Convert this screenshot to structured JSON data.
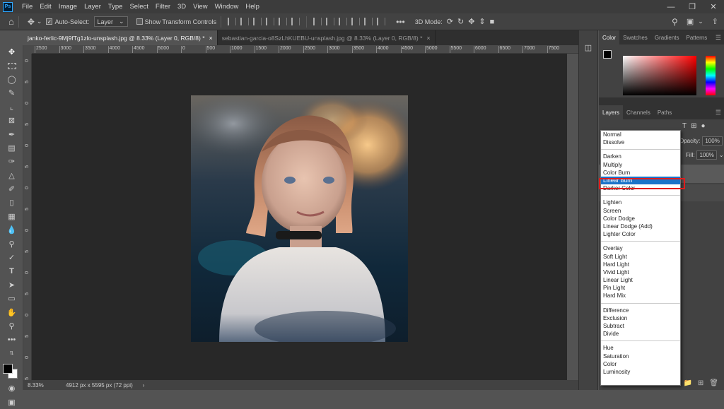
{
  "app": {
    "logo": "Ps"
  },
  "menu": [
    "File",
    "Edit",
    "Image",
    "Layer",
    "Type",
    "Select",
    "Filter",
    "3D",
    "View",
    "Window",
    "Help"
  ],
  "options": {
    "auto_select_label": "Auto-Select:",
    "auto_select_value": "Layer",
    "show_transform_label": "Show Transform Controls",
    "mode_3d_label": "3D Mode:"
  },
  "tabs": [
    {
      "label": "janko-ferlic-9Mj9fTg1zlo-unsplash.jpg @ 8.33% (Layer 0, RGB/8) *",
      "active": true
    },
    {
      "label": "sebastian-garcia-o8SzLhKUEBU-unsplash.jpg @ 8.33% (Layer 0, RGB/8) *",
      "active": false
    }
  ],
  "ruler_h": [
    "2500",
    "3000",
    "3500",
    "4000",
    "4500",
    "5000",
    "0",
    "500",
    "1000",
    "1500",
    "2000",
    "2500",
    "3000",
    "3500",
    "4000",
    "4500",
    "5000",
    "5500",
    "6000",
    "6500",
    "7000",
    "7500"
  ],
  "ruler_v": [
    "0",
    "5",
    "0",
    "5",
    "0",
    "5",
    "0",
    "5",
    "0",
    "5",
    "0",
    "5",
    "0",
    "5",
    "0",
    "5"
  ],
  "status": {
    "zoom": "8.33%",
    "doc_info": "4912 px x 5595 px (72 ppi)"
  },
  "color_panel": {
    "tabs": [
      "Color",
      "Swatches",
      "Gradients",
      "Patterns"
    ],
    "active": "Color"
  },
  "layers_panel": {
    "tabs": [
      "Layers",
      "Channels",
      "Paths"
    ],
    "active": "Layers",
    "opacity_label": "Opacity:",
    "opacity_value": "100%",
    "fill_label": "Fill:",
    "fill_value": "100%"
  },
  "blend_modes": [
    [
      "Normal",
      "Dissolve"
    ],
    [
      "Darken",
      "Multiply",
      "Color Burn",
      "Linear Burn",
      "Darker Color"
    ],
    [
      "Lighten",
      "Screen",
      "Color Dodge",
      "Linear Dodge (Add)",
      "Lighter Color"
    ],
    [
      "Overlay",
      "Soft Light",
      "Hard Light",
      "Vivid Light",
      "Linear Light",
      "Pin Light",
      "Hard Mix"
    ],
    [
      "Difference",
      "Exclusion",
      "Subtract",
      "Divide"
    ],
    [
      "Hue",
      "Saturation",
      "Color",
      "Luminosity"
    ]
  ],
  "selected_blend_mode": "Linear Burn",
  "colors": {
    "highlight": "#1a73c8",
    "annotation_box": "#e01c1c",
    "fg": "#000000",
    "bg": "#ffffff"
  }
}
